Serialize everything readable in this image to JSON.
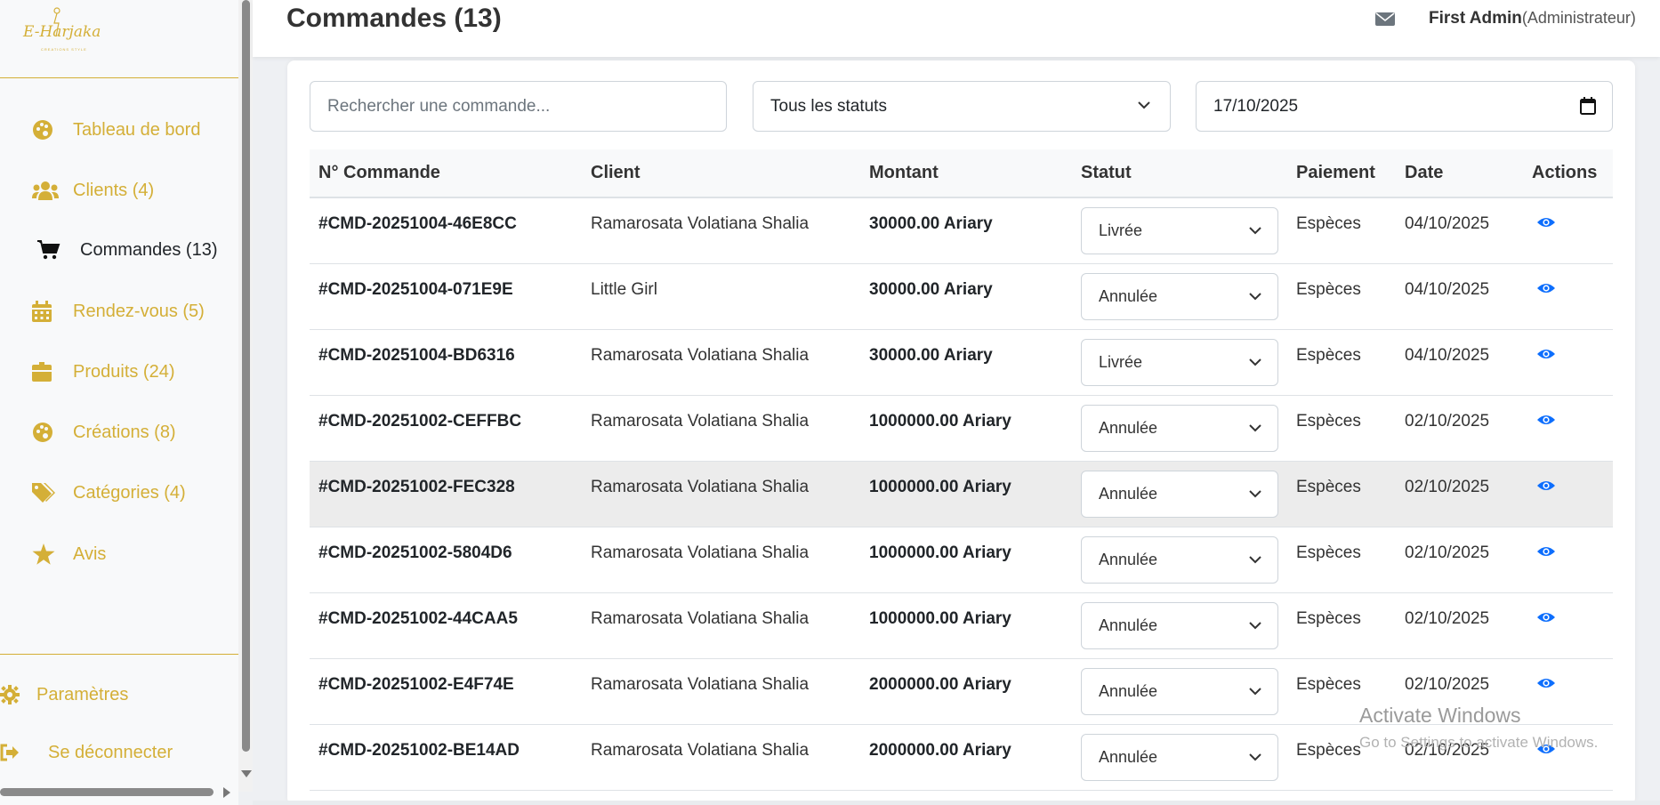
{
  "brand": {
    "logo_text": "E-Harjaka",
    "logo_sub": "CREATIONS STYLE"
  },
  "sidebar": {
    "items": [
      {
        "label": "Tableau de bord",
        "icon": "palette-icon"
      },
      {
        "label": "Clients (4)",
        "icon": "users-icon"
      },
      {
        "label": "Commandes (13)",
        "icon": "cart-icon"
      },
      {
        "label": "Rendez-vous (5)",
        "icon": "calendar-icon"
      },
      {
        "label": "Produits (24)",
        "icon": "box-icon"
      },
      {
        "label": "Créations (8)",
        "icon": "palette-icon"
      },
      {
        "label": "Catégories (4)",
        "icon": "tags-icon"
      },
      {
        "label": "Avis",
        "icon": "star-icon"
      }
    ],
    "settings_label": "Paramètres",
    "logout_label": "Se déconnecter"
  },
  "header": {
    "title": "Commandes (13)",
    "user_name": "First Admin",
    "user_role": "(Administrateur)"
  },
  "filters": {
    "search_placeholder": "Rechercher une commande...",
    "status_value": "Tous les statuts",
    "date_value": "17/10/2025"
  },
  "table": {
    "columns": [
      "N° Commande",
      "Client",
      "Montant",
      "Statut",
      "Paiement",
      "Date",
      "Actions"
    ],
    "rows": [
      {
        "id": "#CMD-20251004-46E8CC",
        "client": "Ramarosata Volatiana Shalia",
        "amount": "30000.00 Ariary",
        "status": "Livrée",
        "payment": "Espèces",
        "date": "04/10/2025"
      },
      {
        "id": "#CMD-20251004-071E9E",
        "client": "Little Girl",
        "amount": "30000.00 Ariary",
        "status": "Annulée",
        "payment": "Espèces",
        "date": "04/10/2025"
      },
      {
        "id": "#CMD-20251004-BD6316",
        "client": "Ramarosata Volatiana Shalia",
        "amount": "30000.00 Ariary",
        "status": "Livrée",
        "payment": "Espèces",
        "date": "04/10/2025"
      },
      {
        "id": "#CMD-20251002-CEFFBC",
        "client": "Ramarosata Volatiana Shalia",
        "amount": "1000000.00 Ariary",
        "status": "Annulée",
        "payment": "Espèces",
        "date": "02/10/2025"
      },
      {
        "id": "#CMD-20251002-FEC328",
        "client": "Ramarosata Volatiana Shalia",
        "amount": "1000000.00 Ariary",
        "status": "Annulée",
        "payment": "Espèces",
        "date": "02/10/2025"
      },
      {
        "id": "#CMD-20251002-5804D6",
        "client": "Ramarosata Volatiana Shalia",
        "amount": "1000000.00 Ariary",
        "status": "Annulée",
        "payment": "Espèces",
        "date": "02/10/2025"
      },
      {
        "id": "#CMD-20251002-44CAA5",
        "client": "Ramarosata Volatiana Shalia",
        "amount": "1000000.00 Ariary",
        "status": "Annulée",
        "payment": "Espèces",
        "date": "02/10/2025"
      },
      {
        "id": "#CMD-20251002-E4F74E",
        "client": "Ramarosata Volatiana Shalia",
        "amount": "2000000.00 Ariary",
        "status": "Annulée",
        "payment": "Espèces",
        "date": "02/10/2025"
      },
      {
        "id": "#CMD-20251002-BE14AD",
        "client": "Ramarosata Volatiana Shalia",
        "amount": "2000000.00 Ariary",
        "status": "Annulée",
        "payment": "Espèces",
        "date": "02/10/2025"
      }
    ]
  },
  "watermark": {
    "line1": "Activate Windows",
    "line2": "Go to Settings to activate Windows."
  },
  "colors": {
    "accent": "#d4af37",
    "action_icon": "#0d6efd"
  }
}
